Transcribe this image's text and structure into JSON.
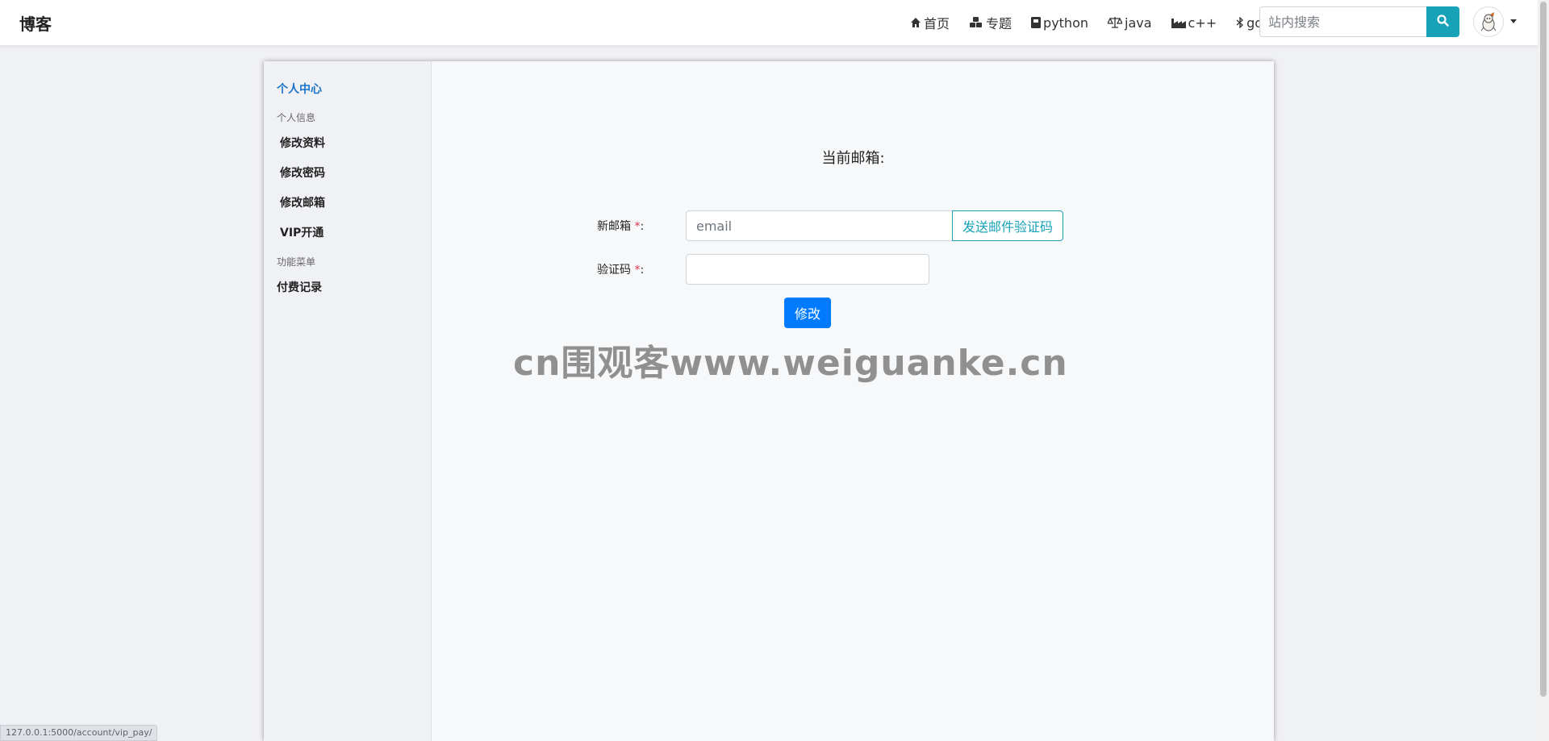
{
  "navbar": {
    "brand": "博客",
    "items": [
      {
        "icon": "home-icon",
        "label": "首页"
      },
      {
        "icon": "cubes-icon",
        "label": "专题"
      },
      {
        "icon": "book-icon",
        "label": "python"
      },
      {
        "icon": "balance-scale-icon",
        "label": "java"
      },
      {
        "icon": "industry-icon",
        "label": "c++"
      },
      {
        "icon": "bluetooth-icon",
        "label": "go"
      }
    ],
    "search_placeholder": "站内搜索"
  },
  "sidebar": {
    "title": "个人中心",
    "group_personal": "个人信息",
    "links": [
      "修改资料",
      "修改密码",
      "修改邮箱",
      "VIP开通"
    ],
    "group_functions": "功能菜单",
    "payment_records": "付费记录"
  },
  "form": {
    "current_email_label": "当前邮箱:",
    "new_email_label": "新邮箱",
    "email_placeholder": "email",
    "send_code_button": "发送邮件验证码",
    "code_label": "验证码",
    "required_mark": "*",
    "label_suffix": ":",
    "submit_button": "修改"
  },
  "watermark": "cn围观客www.weiguanke.cn",
  "status_bar_url": "127.0.0.1:5000/account/vip_pay/",
  "colors": {
    "accent_info": "#17a2b8",
    "primary": "#007bff",
    "sidebar_title": "#1a73c8",
    "required": "#dc3545"
  }
}
